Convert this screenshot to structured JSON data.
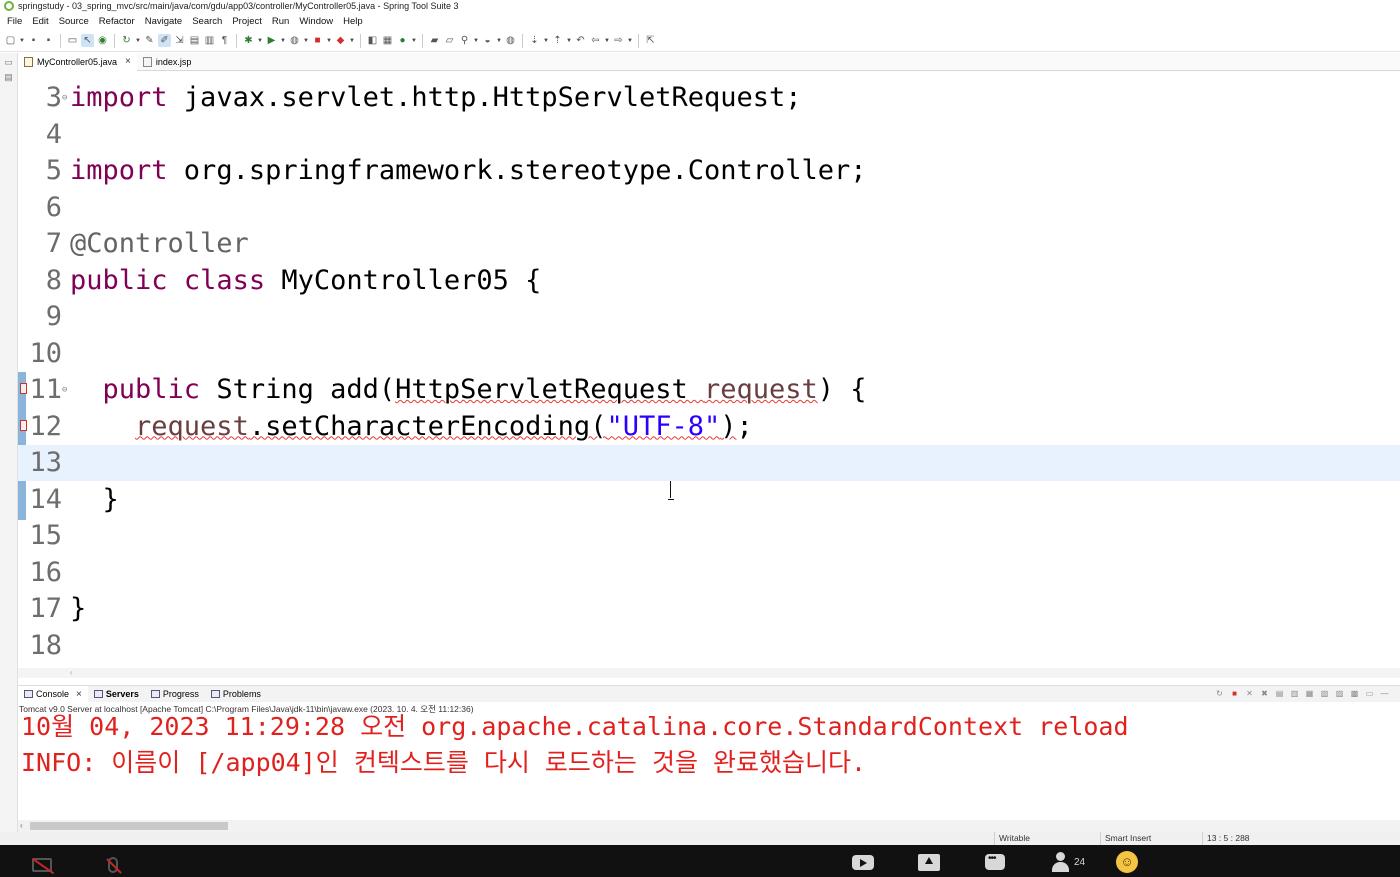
{
  "window": {
    "title": "springstudy - 03_spring_mvc/src/main/java/com/gdu/app03/controller/MyController05.java - Spring Tool Suite 3"
  },
  "menu": [
    "File",
    "Edit",
    "Source",
    "Refactor",
    "Navigate",
    "Search",
    "Project",
    "Run",
    "Window",
    "Help"
  ],
  "editor_tabs": [
    {
      "label": "MyController05.java",
      "close": "×",
      "active": true
    },
    {
      "label": "index.jsp",
      "active": false
    }
  ],
  "code_lines": [
    {
      "num": "3",
      "parts": [
        [
          "kw",
          "import"
        ],
        [
          "",
          " javax.servlet.http.HttpServletRequest;"
        ]
      ]
    },
    {
      "num": "4",
      "parts": []
    },
    {
      "num": "5",
      "parts": [
        [
          "kw",
          "import"
        ],
        [
          "",
          " org.springframework.stereotype.Controller;"
        ]
      ]
    },
    {
      "num": "6",
      "parts": []
    },
    {
      "num": "7",
      "parts": [
        [
          "ann",
          "@Controller"
        ]
      ]
    },
    {
      "num": "8",
      "parts": [
        [
          "kw",
          "public"
        ],
        [
          "",
          " "
        ],
        [
          "kw",
          "class"
        ],
        [
          "",
          " MyController05 {"
        ]
      ]
    },
    {
      "num": "9",
      "parts": []
    },
    {
      "num": "10",
      "parts": []
    },
    {
      "num": "11",
      "parts": [
        [
          "",
          "  "
        ],
        [
          "kw",
          "public"
        ],
        [
          "",
          " String add("
        ],
        [
          "err",
          "HttpServletRequest "
        ],
        [
          "var err",
          "request"
        ],
        [
          "",
          ") {"
        ]
      ]
    },
    {
      "num": "12",
      "parts": [
        [
          "",
          "    "
        ],
        [
          "var err",
          "request"
        ],
        [
          "err",
          ".setCharacterEncoding("
        ],
        [
          "str err",
          "\"UTF-8\""
        ],
        [
          "err",
          ")"
        ],
        [
          "",
          ";"
        ]
      ]
    },
    {
      "num": "13",
      "parts": []
    },
    {
      "num": "14",
      "parts": [
        [
          "",
          "  }"
        ]
      ]
    },
    {
      "num": "15",
      "parts": []
    },
    {
      "num": "16",
      "parts": []
    },
    {
      "num": "17",
      "parts": [
        [
          "",
          "}"
        ]
      ]
    },
    {
      "num": "18",
      "parts": []
    }
  ],
  "console": {
    "tabs": [
      {
        "label": "Console",
        "close": "×"
      },
      {
        "label": "Servers"
      },
      {
        "label": "Progress"
      },
      {
        "label": "Problems"
      }
    ],
    "description": "Tomcat v9.0 Server at localhost [Apache Tomcat] C:\\Program Files\\Java\\jdk-11\\bin\\javaw.exe  (2023. 10. 4. 오전 11:12:36)",
    "lines": [
      "10월 04, 2023 11:29:28 오전 org.apache.catalina.core.StandardContext reload",
      "INFO: 이름이 [/app04]인 컨텍스트를 다시 로드하는 것을 완료했습니다."
    ],
    "text_color": "#e0221f"
  },
  "status": {
    "writable": "Writable",
    "insert_mode": "Smart Insert",
    "position": "13 : 5 : 288"
  },
  "meeting_bar": {
    "participants": "24"
  },
  "colors": {
    "keyword": "#7f0055",
    "annotation": "#646464",
    "string": "#2a00ff",
    "variable": "#6a3e3e",
    "current_line": "#e8f2fe"
  }
}
